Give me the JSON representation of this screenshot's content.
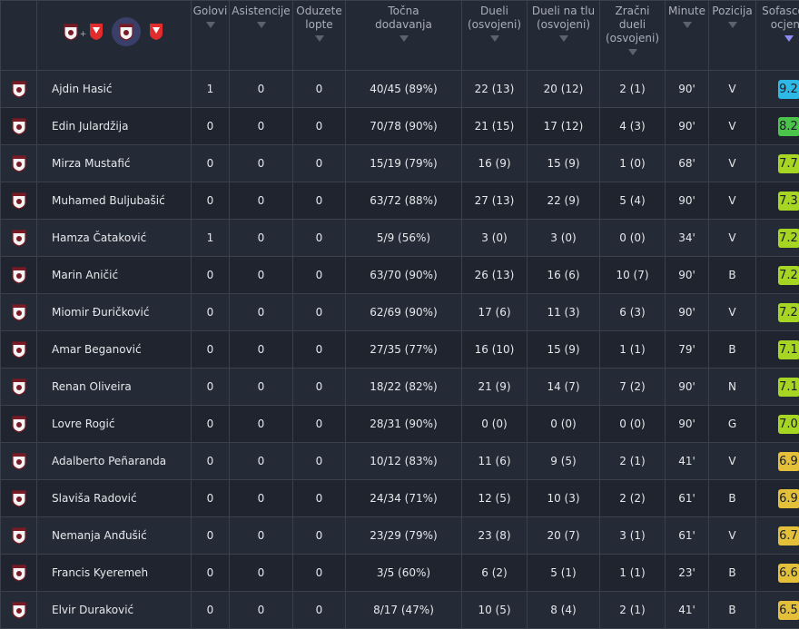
{
  "header": {
    "columns": [
      {
        "key": "goals",
        "label": "Golovi"
      },
      {
        "key": "assists",
        "label": "Asistencije"
      },
      {
        "key": "tackles",
        "label": "Oduzete\nlopte"
      },
      {
        "key": "passes",
        "label": "Točna\ndodavanja"
      },
      {
        "key": "duels",
        "label": "Dueli\n(osvojeni)"
      },
      {
        "key": "ground_duels",
        "label": "Dueli na tlu\n(osvojeni)"
      },
      {
        "key": "aerial_duels",
        "label": "Zračni\ndueli\n(osvojeni)"
      },
      {
        "key": "minutes",
        "label": "Minute"
      },
      {
        "key": "position",
        "label": "Pozicija"
      },
      {
        "key": "rating",
        "label": "Sofascore\nocjena"
      }
    ],
    "team_selector": {
      "plus_label": "+"
    }
  },
  "colors": {
    "accent": "#8d8cf5",
    "rating_blue": "#2db8e6",
    "rating_green": "#4ac44a",
    "rating_lime": "#a6d623",
    "rating_yellow": "#e4c03a"
  },
  "players": [
    {
      "name": "Ajdin Hasić",
      "goals": "1",
      "assists": "0",
      "tackles": "0",
      "passes": "40/45 (89%)",
      "duels": "22 (13)",
      "ground_duels": "20 (12)",
      "aerial_duels": "2 (1)",
      "minutes": "90'",
      "position": "V",
      "rating": "9.2",
      "rating_color": "#2db8e6"
    },
    {
      "name": "Edin Julardžija",
      "goals": "0",
      "assists": "0",
      "tackles": "0",
      "passes": "70/78 (90%)",
      "duels": "21 (15)",
      "ground_duels": "17 (12)",
      "aerial_duels": "4 (3)",
      "minutes": "90'",
      "position": "V",
      "rating": "8.2",
      "rating_color": "#4ac44a"
    },
    {
      "name": "Mirza Mustafić",
      "goals": "0",
      "assists": "0",
      "tackles": "0",
      "passes": "15/19 (79%)",
      "duels": "16 (9)",
      "ground_duels": "15 (9)",
      "aerial_duels": "1 (0)",
      "minutes": "68'",
      "position": "V",
      "rating": "7.7",
      "rating_color": "#a6d623"
    },
    {
      "name": "Muhamed Buljubašić",
      "goals": "0",
      "assists": "0",
      "tackles": "0",
      "passes": "63/72 (88%)",
      "duels": "27 (13)",
      "ground_duels": "22 (9)",
      "aerial_duels": "5 (4)",
      "minutes": "90'",
      "position": "V",
      "rating": "7.3",
      "rating_color": "#a6d623"
    },
    {
      "name": "Hamza Čataković",
      "goals": "1",
      "assists": "0",
      "tackles": "0",
      "passes": "5/9 (56%)",
      "duels": "3 (0)",
      "ground_duels": "3 (0)",
      "aerial_duels": "0 (0)",
      "minutes": "34'",
      "position": "V",
      "rating": "7.2",
      "rating_color": "#a6d623"
    },
    {
      "name": "Marin Aničić",
      "goals": "0",
      "assists": "0",
      "tackles": "0",
      "passes": "63/70 (90%)",
      "duels": "26 (13)",
      "ground_duels": "16 (6)",
      "aerial_duels": "10 (7)",
      "minutes": "90'",
      "position": "B",
      "rating": "7.2",
      "rating_color": "#a6d623"
    },
    {
      "name": "Miomir Đuričković",
      "goals": "0",
      "assists": "0",
      "tackles": "0",
      "passes": "62/69 (90%)",
      "duels": "17 (6)",
      "ground_duels": "11 (3)",
      "aerial_duels": "6 (3)",
      "minutes": "90'",
      "position": "V",
      "rating": "7.2",
      "rating_color": "#a6d623"
    },
    {
      "name": "Amar Beganović",
      "goals": "0",
      "assists": "0",
      "tackles": "0",
      "passes": "27/35 (77%)",
      "duels": "16 (10)",
      "ground_duels": "15 (9)",
      "aerial_duels": "1 (1)",
      "minutes": "79'",
      "position": "B",
      "rating": "7.1",
      "rating_color": "#a6d623"
    },
    {
      "name": "Renan Oliveira",
      "goals": "0",
      "assists": "0",
      "tackles": "0",
      "passes": "18/22 (82%)",
      "duels": "21 (9)",
      "ground_duels": "14 (7)",
      "aerial_duels": "7 (2)",
      "minutes": "90'",
      "position": "N",
      "rating": "7.1",
      "rating_color": "#a6d623"
    },
    {
      "name": "Lovre Rogić",
      "goals": "0",
      "assists": "0",
      "tackles": "0",
      "passes": "28/31 (90%)",
      "duels": "0 (0)",
      "ground_duels": "0 (0)",
      "aerial_duels": "0 (0)",
      "minutes": "90'",
      "position": "G",
      "rating": "7.0",
      "rating_color": "#a6d623"
    },
    {
      "name": "Adalberto Peñaranda",
      "goals": "0",
      "assists": "0",
      "tackles": "0",
      "passes": "10/12 (83%)",
      "duels": "11 (6)",
      "ground_duels": "9 (5)",
      "aerial_duels": "2 (1)",
      "minutes": "41'",
      "position": "V",
      "rating": "6.9",
      "rating_color": "#e4c03a"
    },
    {
      "name": "Slaviša Radović",
      "goals": "0",
      "assists": "0",
      "tackles": "0",
      "passes": "24/34 (71%)",
      "duels": "12 (5)",
      "ground_duels": "10 (3)",
      "aerial_duels": "2 (2)",
      "minutes": "61'",
      "position": "B",
      "rating": "6.9",
      "rating_color": "#e4c03a"
    },
    {
      "name": "Nemanja Anđušić",
      "goals": "0",
      "assists": "0",
      "tackles": "0",
      "passes": "23/29 (79%)",
      "duels": "23 (8)",
      "ground_duels": "20 (7)",
      "aerial_duels": "3 (1)",
      "minutes": "61'",
      "position": "V",
      "rating": "6.7",
      "rating_color": "#e4c03a"
    },
    {
      "name": "Francis Kyeremeh",
      "goals": "0",
      "assists": "0",
      "tackles": "0",
      "passes": "3/5 (60%)",
      "duels": "6 (2)",
      "ground_duels": "5 (1)",
      "aerial_duels": "1 (1)",
      "minutes": "23'",
      "position": "B",
      "rating": "6.6",
      "rating_color": "#e4c03a"
    },
    {
      "name": "Elvir Duraković",
      "goals": "0",
      "assists": "0",
      "tackles": "0",
      "passes": "8/17 (47%)",
      "duels": "10 (5)",
      "ground_duels": "8 (4)",
      "aerial_duels": "2 (1)",
      "minutes": "41'",
      "position": "B",
      "rating": "6.5",
      "rating_color": "#e4c03a"
    }
  ]
}
